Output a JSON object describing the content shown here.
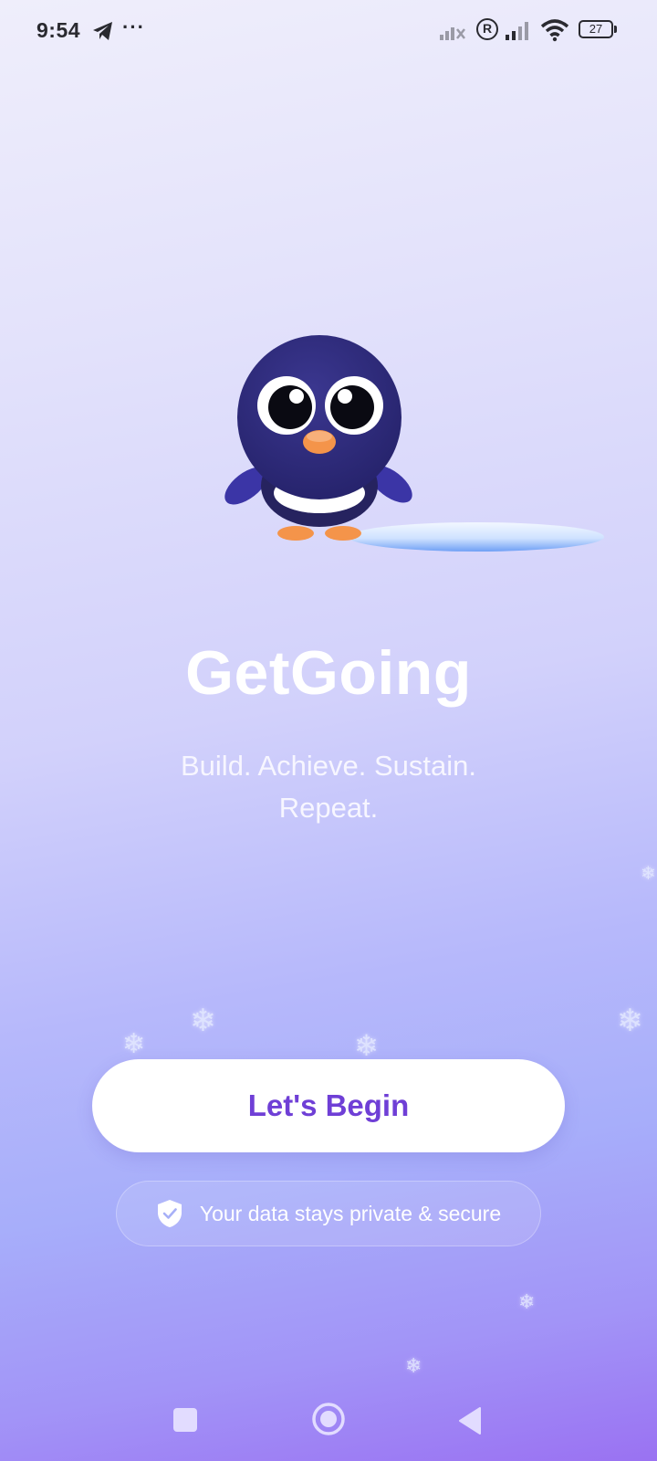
{
  "status_bar": {
    "time": "9:54",
    "battery_level": "27",
    "icons": [
      "telegram-icon",
      "more-dots-icon",
      "signal-off-icon",
      "registered-icon",
      "signal-icon",
      "wifi-icon",
      "battery-icon"
    ],
    "more_glyph": "···",
    "reg_glyph": "R"
  },
  "app": {
    "title": "GetGoing",
    "tagline": "Build. Achieve. Sustain. Repeat."
  },
  "actions": {
    "begin_label": "Let's Begin"
  },
  "privacy": {
    "text": "Your data stays private & secure",
    "icon": "shield-check-icon"
  },
  "nav_bar": {
    "buttons": [
      "recents-button",
      "home-button",
      "back-button"
    ]
  },
  "colors": {
    "accent": "#6f3fd6",
    "mascot_body": "#2e2a7a",
    "beak": "#f4944a"
  }
}
